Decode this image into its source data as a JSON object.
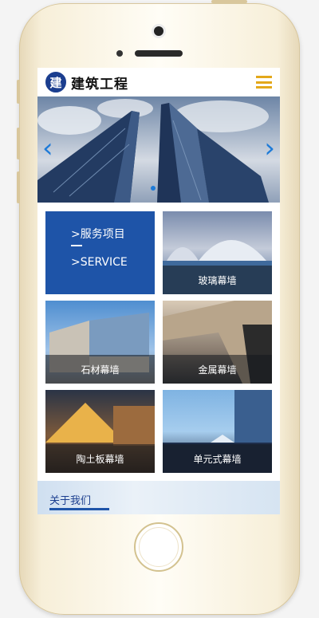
{
  "header": {
    "logo_char": "建",
    "site_name": "建筑工程"
  },
  "banner": {
    "prev_icon": "‹",
    "next_icon": "›"
  },
  "service": {
    "title": ">服务项目",
    "subtitle": ">SERVICE"
  },
  "tiles": [
    {
      "label": "玻璃幕墙"
    },
    {
      "label": "石材幕墙"
    },
    {
      "label": "金属幕墙"
    },
    {
      "label": "陶土板幕墙"
    },
    {
      "label": "单元式幕墙"
    }
  ],
  "about": {
    "title": "关于我们"
  },
  "colors": {
    "brand_blue": "#1e54a8",
    "menu_yellow": "#e3a81a",
    "arrow_blue": "#1e7bd8"
  }
}
